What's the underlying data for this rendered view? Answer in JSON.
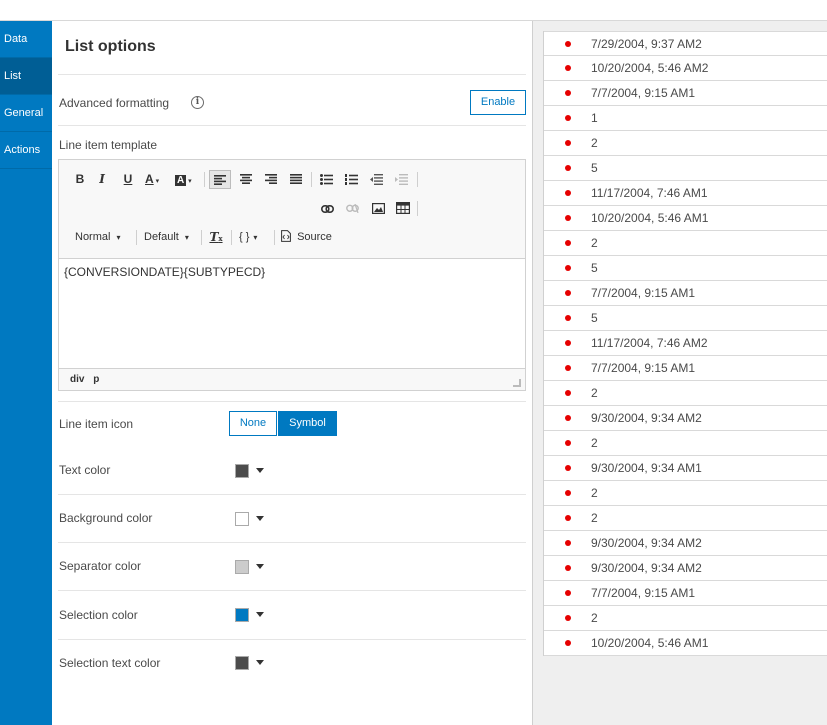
{
  "nav": {
    "items": [
      {
        "label": "Data",
        "active": false
      },
      {
        "label": "List",
        "active": true
      },
      {
        "label": "General",
        "active": false
      },
      {
        "label": "Actions",
        "active": false
      }
    ]
  },
  "panel": {
    "title": "List options",
    "advanced_formatting_label": "Advanced formatting",
    "info_icon": "i",
    "enable_label": "Enable",
    "line_item_template_label": "Line item template",
    "toolbar": {
      "bold": "B",
      "italic": "I",
      "underline": "U",
      "text_color": "A",
      "bg_color": "A",
      "format_select": "Normal",
      "font_select": "Default",
      "remove_format": "T",
      "braces": "{ }",
      "source_label": "Source"
    },
    "template_text": "{CONVERSIONDATE}{SUBTYPECD}",
    "element_path": [
      "div",
      "p"
    ],
    "line_item_icon_label": "Line item icon",
    "icon_none": "None",
    "icon_symbol": "Symbol",
    "colors": [
      {
        "label": "Text color",
        "value": "#4c4c4c"
      },
      {
        "label": "Background color",
        "value": "#ffffff"
      },
      {
        "label": "Separator color",
        "value": "#cccccc"
      },
      {
        "label": "Selection color",
        "value": "#0079c1"
      },
      {
        "label": "Selection text color",
        "value": "#4c4c4c"
      }
    ]
  },
  "preview": {
    "dot_color": "#e60000",
    "items": [
      "7/29/2004, 9:37 AM2",
      "10/20/2004, 5:46 AM2",
      "7/7/2004, 9:15 AM1",
      "1",
      "2",
      "5",
      "11/17/2004, 7:46 AM1",
      "10/20/2004, 5:46 AM1",
      "2",
      "5",
      "7/7/2004, 9:15 AM1",
      "5",
      "11/17/2004, 7:46 AM2",
      "7/7/2004, 9:15 AM1",
      "2",
      "9/30/2004, 9:34 AM2",
      "2",
      "9/30/2004, 9:34 AM1",
      "2",
      "2",
      "9/30/2004, 9:34 AM2",
      "9/30/2004, 9:34 AM2",
      "7/7/2004, 9:15 AM1",
      "2",
      "10/20/2004, 5:46 AM1"
    ]
  }
}
